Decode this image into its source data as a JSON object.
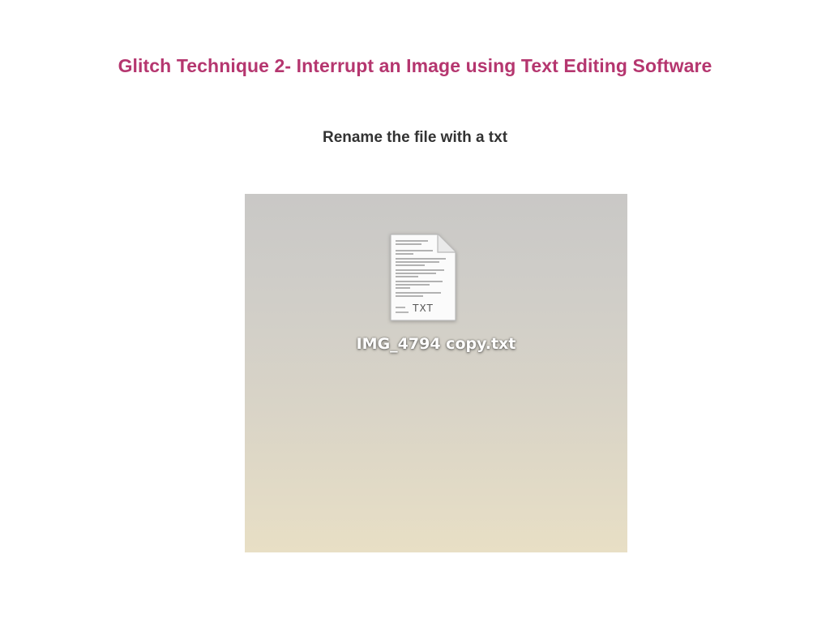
{
  "slide": {
    "title": "Glitch Technique 2- Interrupt an Image using Text Editing Software",
    "subtitle": "Rename the file with a txt"
  },
  "desktop": {
    "file_icon": "text-document-icon",
    "file_extension_label": "TXT",
    "file_name": "IMG_4794 copy.txt"
  },
  "colors": {
    "title": "#b5366f",
    "subtitle": "#333333",
    "background": "#ffffff"
  }
}
